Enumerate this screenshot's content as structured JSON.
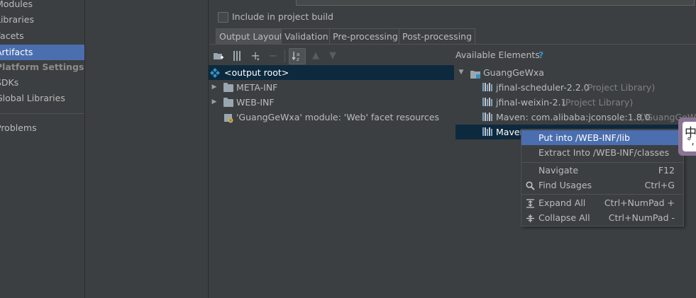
{
  "sidebar": {
    "items": [
      {
        "label": "Modules"
      },
      {
        "label": "Libraries"
      },
      {
        "label": "Facets"
      },
      {
        "label": "Artifacts"
      },
      {
        "label": "Platform Settings"
      },
      {
        "label": "SDKs"
      },
      {
        "label": "Global Libraries"
      },
      {
        "label": "Problems"
      }
    ]
  },
  "options": {
    "include_in_build_label": "Include in project build"
  },
  "tabs": [
    {
      "label": "Output Layout"
    },
    {
      "label": "Validation"
    },
    {
      "label": "Pre-processing"
    },
    {
      "label": "Post-processing"
    }
  ],
  "toolbar": {
    "icons": [
      "new-folder-icon",
      "archive-icon",
      "add-icon",
      "remove-icon",
      "sort-icon",
      "move-up-icon",
      "move-down-icon"
    ]
  },
  "output_tree": {
    "root": "<output root>",
    "items": [
      {
        "label": "META-INF"
      },
      {
        "label": "WEB-INF"
      },
      {
        "label": "'GuangGeWxa' module: 'Web' facet resources"
      }
    ]
  },
  "available": {
    "label": "Available Elements",
    "help": "?",
    "module": "GuangGeWxa",
    "libraries": [
      {
        "name": "jfinal-scheduler-2.2.0",
        "note": "(Project Library)"
      },
      {
        "name": "jfinal-weixin-2.1",
        "note": "(Project Library)"
      },
      {
        "name": "Maven: com.alibaba:jconsole:1.8.0",
        "note": "('GuangGeW"
      },
      {
        "name": "Maven",
        "note": ""
      }
    ]
  },
  "context_menu": {
    "items": [
      {
        "label": "Put into /WEB-INF/lib",
        "shortcut": ""
      },
      {
        "label": "Extract Into /WEB-INF/classes",
        "shortcut": ""
      },
      {
        "label": "Navigate",
        "shortcut": "F12"
      },
      {
        "label": "Find Usages",
        "shortcut": "Ctrl+G"
      },
      {
        "label": "Expand All",
        "shortcut": "Ctrl+NumPad +"
      },
      {
        "label": "Collapse All",
        "shortcut": "Ctrl+NumPad -"
      }
    ]
  },
  "ime": {
    "char": "中",
    "punct": "°,"
  },
  "colors": {
    "background": "#3c3f41",
    "selection": "#4b6eaf",
    "tree_selection": "#0d293e",
    "help_accent": "#3592c4"
  }
}
